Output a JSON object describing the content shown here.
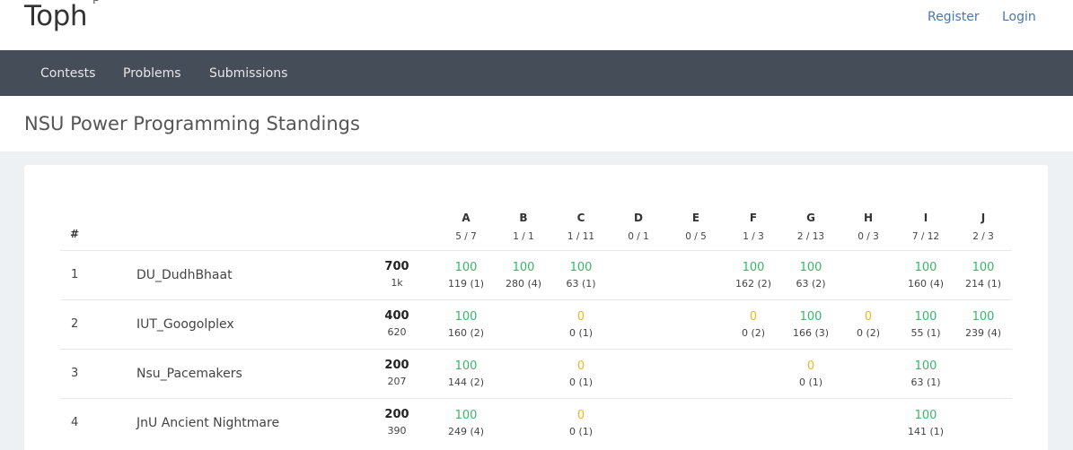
{
  "brand": {
    "name": "Toph",
    "beta": "β"
  },
  "header": {
    "register": "Register",
    "login": "Login"
  },
  "nav": {
    "contests": "Contests",
    "problems": "Problems",
    "submissions": "Submissions"
  },
  "page_title": "NSU Power Programming Standings",
  "colors": {
    "solved": "#3db36a",
    "attempted": "#f0b322",
    "navbar": "#444d58"
  },
  "table": {
    "rank_header": "#",
    "problems": [
      {
        "letter": "A",
        "stats": "5 / 7"
      },
      {
        "letter": "B",
        "stats": "1 / 1"
      },
      {
        "letter": "C",
        "stats": "1 / 11"
      },
      {
        "letter": "D",
        "stats": "0 / 1"
      },
      {
        "letter": "E",
        "stats": "0 / 5"
      },
      {
        "letter": "F",
        "stats": "1 / 3"
      },
      {
        "letter": "G",
        "stats": "2 / 13"
      },
      {
        "letter": "H",
        "stats": "0 / 3"
      },
      {
        "letter": "I",
        "stats": "7 / 12"
      },
      {
        "letter": "J",
        "stats": "2 / 3"
      }
    ],
    "rows": [
      {
        "rank": "1",
        "team": "DU_DudhBhaat",
        "score": "700",
        "penalty": "1k",
        "cells": [
          {
            "pts": "100",
            "detail": "119 (1)",
            "solved": true
          },
          {
            "pts": "100",
            "detail": "280 (4)",
            "solved": true
          },
          {
            "pts": "100",
            "detail": "63 (1)",
            "solved": true
          },
          null,
          null,
          {
            "pts": "100",
            "detail": "162 (2)",
            "solved": true
          },
          {
            "pts": "100",
            "detail": "63 (2)",
            "solved": true
          },
          null,
          {
            "pts": "100",
            "detail": "160 (4)",
            "solved": true
          },
          {
            "pts": "100",
            "detail": "214 (1)",
            "solved": true
          }
        ]
      },
      {
        "rank": "2",
        "team": "IUT_Googolplex",
        "score": "400",
        "penalty": "620",
        "cells": [
          {
            "pts": "100",
            "detail": "160 (2)",
            "solved": true
          },
          null,
          {
            "pts": "0",
            "detail": "0 (1)",
            "solved": false
          },
          null,
          null,
          {
            "pts": "0",
            "detail": "0 (2)",
            "solved": false
          },
          {
            "pts": "100",
            "detail": "166 (3)",
            "solved": true
          },
          {
            "pts": "0",
            "detail": "0 (2)",
            "solved": false
          },
          {
            "pts": "100",
            "detail": "55 (1)",
            "solved": true
          },
          {
            "pts": "100",
            "detail": "239 (4)",
            "solved": true
          }
        ]
      },
      {
        "rank": "3",
        "team": "Nsu_Pacemakers",
        "score": "200",
        "penalty": "207",
        "cells": [
          {
            "pts": "100",
            "detail": "144 (2)",
            "solved": true
          },
          null,
          {
            "pts": "0",
            "detail": "0 (1)",
            "solved": false
          },
          null,
          null,
          null,
          {
            "pts": "0",
            "detail": "0 (1)",
            "solved": false
          },
          null,
          {
            "pts": "100",
            "detail": "63 (1)",
            "solved": true
          },
          null
        ]
      },
      {
        "rank": "4",
        "team": "JnU Ancient Nightmare",
        "score": "200",
        "penalty": "390",
        "cells": [
          {
            "pts": "100",
            "detail": "249 (4)",
            "solved": true
          },
          null,
          {
            "pts": "0",
            "detail": "0 (1)",
            "solved": false
          },
          null,
          null,
          null,
          null,
          null,
          {
            "pts": "100",
            "detail": "141 (1)",
            "solved": true
          },
          null
        ]
      }
    ]
  }
}
